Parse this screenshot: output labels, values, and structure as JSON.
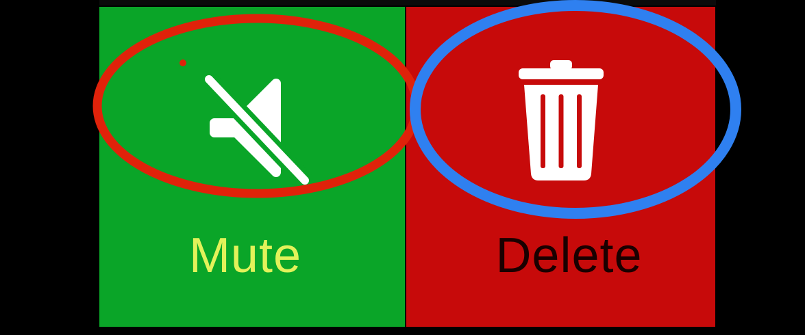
{
  "actions": {
    "mute": {
      "label": "Mute",
      "icon": "speaker-muted-icon",
      "background_color": "#0aa528",
      "label_color": "#e2f25a"
    },
    "delete": {
      "label": "Delete",
      "icon": "trash-icon",
      "background_color": "#c70a0a",
      "label_color": "#1a0000"
    }
  },
  "annotations": {
    "red_circle_color": "#e0220a",
    "blue_circle_color": "#2f80f0"
  }
}
